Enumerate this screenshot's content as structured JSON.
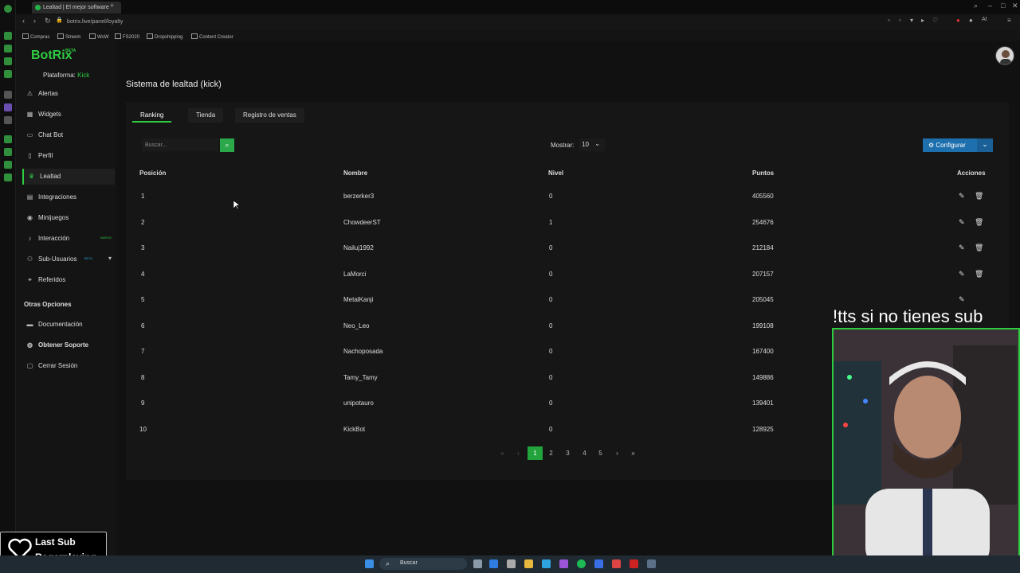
{
  "browser": {
    "tab_title": "Lealtad | El mejor software",
    "url": "botrix.live/panel/loyalty",
    "bookmarks": [
      "Compras",
      "Streem",
      "WoW",
      "FS2020",
      "Dropshipping",
      "Content Creator"
    ]
  },
  "brand": {
    "name": "BotRix",
    "beta": "BETA",
    "accent": "#2ecc40"
  },
  "platform": {
    "label": "Plataforma:",
    "value": "Kick"
  },
  "sidebar": {
    "items": [
      {
        "label": "Alertas",
        "icon": "warning-icon"
      },
      {
        "label": "Widgets",
        "icon": "widgets-icon"
      },
      {
        "label": "Chat Bot",
        "icon": "chat-icon"
      },
      {
        "label": "Perfil",
        "icon": "profile-icon"
      },
      {
        "label": "Lealtad",
        "icon": "trophy-icon",
        "active": true
      },
      {
        "label": "Integraciones",
        "icon": "integrations-icon"
      },
      {
        "label": "Minijuegos",
        "icon": "gamepad-icon"
      },
      {
        "label": "Interacción",
        "icon": "music-icon",
        "badge": "NUEVO"
      },
      {
        "label": "Sub-Usuarios",
        "icon": "users-icon",
        "badge": "BETA"
      },
      {
        "label": "Referidos",
        "icon": "referrals-icon"
      }
    ],
    "other_heading": "Otras Opciones",
    "other_items": [
      {
        "label": "Documentación",
        "icon": "book-icon"
      },
      {
        "label": "Obtener Soporte",
        "icon": "support-icon"
      },
      {
        "label": "Cerrar Sesión",
        "icon": "logout-icon"
      }
    ]
  },
  "page": {
    "title": "Sistema de lealtad (kick)",
    "tabs": [
      "Ranking",
      "Tienda",
      "Registro de ventas"
    ],
    "search_placeholder": "Buscar...",
    "show_label": "Mostrar:",
    "show_value": "10",
    "configure_label": "Configurar"
  },
  "table": {
    "headers": [
      "Posición",
      "Nombre",
      "Nivel",
      "Puntos",
      "Acciones"
    ],
    "rows": [
      {
        "pos": "1",
        "name": "berzerker3",
        "level": "0",
        "points": "405560"
      },
      {
        "pos": "2",
        "name": "ChowdeerST",
        "level": "1",
        "points": "254676"
      },
      {
        "pos": "3",
        "name": "Nailuj1992",
        "level": "0",
        "points": "212184"
      },
      {
        "pos": "4",
        "name": "LaMorci",
        "level": "0",
        "points": "207157"
      },
      {
        "pos": "5",
        "name": "MetalKanji",
        "level": "0",
        "points": "205045"
      },
      {
        "pos": "6",
        "name": "Neo_Leo",
        "level": "0",
        "points": "199108"
      },
      {
        "pos": "7",
        "name": "Nachoposada",
        "level": "0",
        "points": "167400"
      },
      {
        "pos": "8",
        "name": "Tamy_Tamy",
        "level": "0",
        "points": "149886"
      },
      {
        "pos": "9",
        "name": "unipotauro",
        "level": "0",
        "points": "139401"
      },
      {
        "pos": "10",
        "name": "KickBot",
        "level": "0",
        "points": "128925"
      }
    ]
  },
  "pagination": {
    "pages": [
      "1",
      "2",
      "3",
      "4",
      "5"
    ],
    "current": "1"
  },
  "overlay": {
    "tts": "!tts si no tienes sub",
    "last_sub_title": "Last Sub",
    "last_sub_name": "Rogerplaying"
  },
  "taskbar": {
    "search_label": "Buscar"
  }
}
